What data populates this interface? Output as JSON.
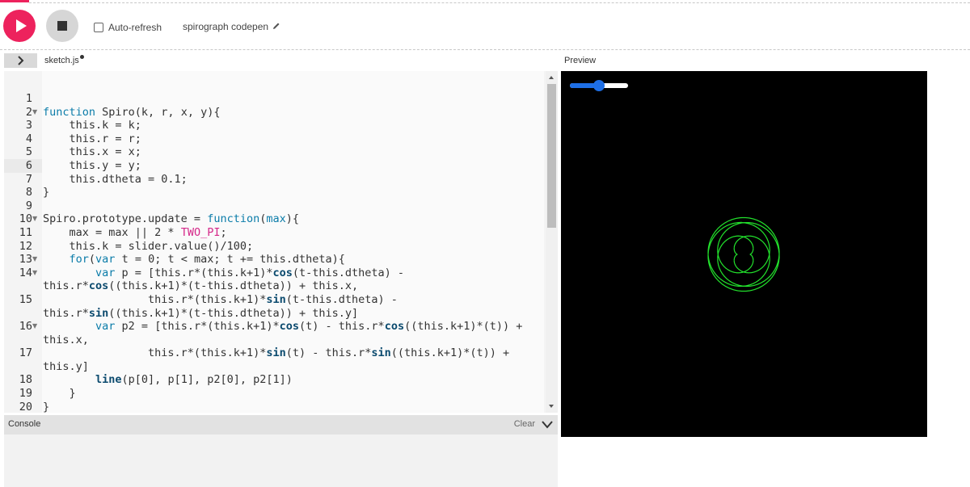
{
  "toolbar": {
    "play_icon": "play-icon",
    "stop_icon": "stop-icon",
    "auto_refresh_label": "Auto-refresh",
    "auto_refresh_checked": false,
    "project_name": "spirograph codepen",
    "edit_icon": "pencil-icon"
  },
  "editor": {
    "file_name": "sketch.js",
    "active_line": 6,
    "lines": [
      {
        "num": "1",
        "fold": false,
        "code": ""
      },
      {
        "num": "2",
        "fold": true,
        "code": "function Spiro(k, r, x, y){"
      },
      {
        "num": "3",
        "fold": false,
        "code": "    this.k = k;"
      },
      {
        "num": "4",
        "fold": false,
        "code": "    this.r = r;"
      },
      {
        "num": "5",
        "fold": false,
        "code": "    this.x = x;"
      },
      {
        "num": "6",
        "fold": false,
        "code": "    this.y = y;"
      },
      {
        "num": "7",
        "fold": false,
        "code": "    this.dtheta = 0.1;"
      },
      {
        "num": "8",
        "fold": false,
        "code": "}"
      },
      {
        "num": "9",
        "fold": false,
        "code": ""
      },
      {
        "num": "10",
        "fold": true,
        "code": "Spiro.prototype.update = function(max){"
      },
      {
        "num": "11",
        "fold": false,
        "code": "    max = max || 2 * TWO_PI;"
      },
      {
        "num": "12",
        "fold": false,
        "code": "    this.k = slider.value()/100;"
      },
      {
        "num": "13",
        "fold": true,
        "code": "    for(var t = 0; t < max; t += this.dtheta){"
      },
      {
        "num": "14",
        "fold": true,
        "code": "        var p = [this.r*(this.k+1)*cos(t-this.dtheta) -"
      },
      {
        "num": "",
        "fold": false,
        "code": "this.r*cos((this.k+1)*(t-this.dtheta)) + this.x,"
      },
      {
        "num": "15",
        "fold": false,
        "code": "                this.r*(this.k+1)*sin(t-this.dtheta) -"
      },
      {
        "num": "",
        "fold": false,
        "code": "this.r*sin((this.k+1)*(t-this.dtheta)) + this.y]"
      },
      {
        "num": "16",
        "fold": true,
        "code": "        var p2 = [this.r*(this.k+1)*cos(t) - this.r*cos((this.k+1)*(t)) +"
      },
      {
        "num": "",
        "fold": false,
        "code": "this.x,"
      },
      {
        "num": "17",
        "fold": false,
        "code": "                this.r*(this.k+1)*sin(t) - this.r*sin((this.k+1)*(t)) +"
      },
      {
        "num": "",
        "fold": false,
        "code": "this.y]"
      },
      {
        "num": "18",
        "fold": false,
        "code": "        line(p[0], p[1], p2[0], p2[1])"
      },
      {
        "num": "19",
        "fold": false,
        "code": "    }"
      },
      {
        "num": "20",
        "fold": false,
        "code": "}"
      }
    ]
  },
  "console": {
    "title": "Console",
    "clear_label": "Clear",
    "collapse_icon": "chevron-down-icon"
  },
  "preview": {
    "label": "Preview",
    "slider_value": 0.5,
    "stroke_color": "#22e02c",
    "background": "#000000"
  },
  "colors": {
    "accent": "#ed225d",
    "keyword": "#0b7ca9",
    "builtin_fn": "#0b4a6e",
    "constant": "#d52889",
    "slider": "#1e6fe6"
  }
}
